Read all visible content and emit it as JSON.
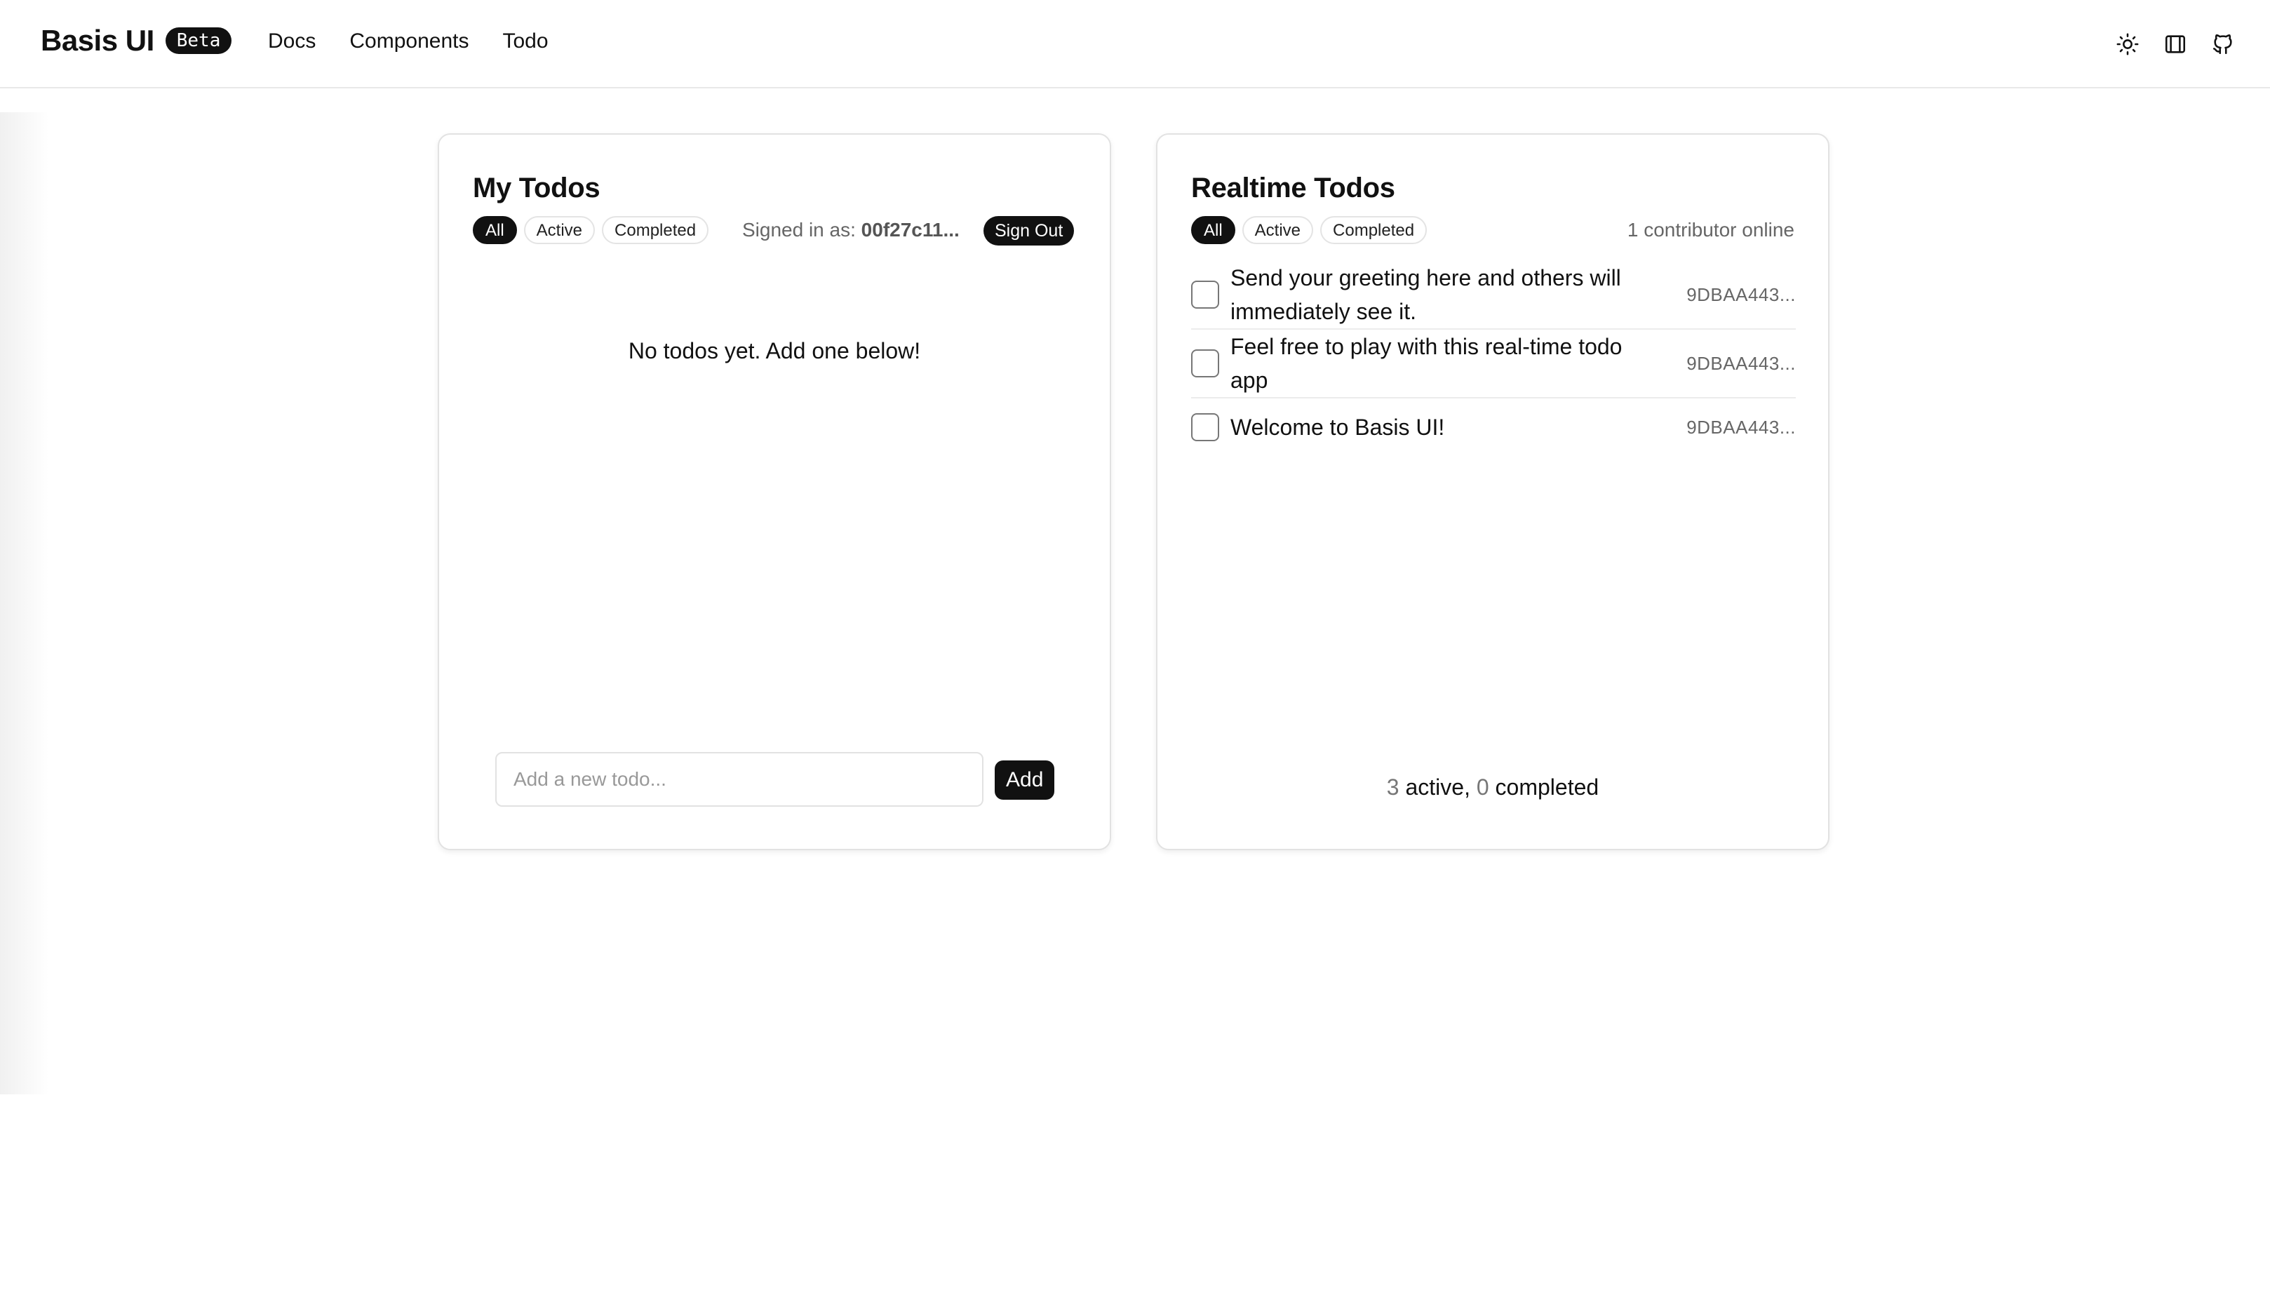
{
  "header": {
    "brand": "Basis UI",
    "badge": "Beta",
    "nav": [
      "Docs",
      "Components",
      "Todo"
    ],
    "icons": [
      "sun-icon",
      "sidebar-layout-icon",
      "github-icon"
    ]
  },
  "my_todos": {
    "title": "My Todos",
    "filters": [
      "All",
      "Active",
      "Completed"
    ],
    "active_filter": "All",
    "signed_in_label": "Signed in as:",
    "user_id": "00f27c11...",
    "sign_out": "Sign Out",
    "empty_message": "No todos yet. Add one below!",
    "input_placeholder": "Add a new todo...",
    "input_value": "",
    "add_label": "Add"
  },
  "realtime_todos": {
    "title": "Realtime Todos",
    "filters": [
      "All",
      "Active",
      "Completed"
    ],
    "active_filter": "All",
    "contributors": "1 contributor online",
    "items": [
      {
        "text": "Send your greeting here and others will immediately see it.",
        "owner": "9DBAA443...",
        "completed": false
      },
      {
        "text": "Feel free to play with this real-time todo app",
        "owner": "9DBAA443...",
        "completed": false
      },
      {
        "text": "Welcome to Basis UI!",
        "owner": "9DBAA443...",
        "completed": false
      }
    ],
    "summary": {
      "active_count": "3",
      "active_label": " active, ",
      "completed_count": "0",
      "completed_label": " completed"
    }
  },
  "colors": {
    "accent": "#111111",
    "border": "#e2e2e2",
    "muted_text": "#666666"
  }
}
